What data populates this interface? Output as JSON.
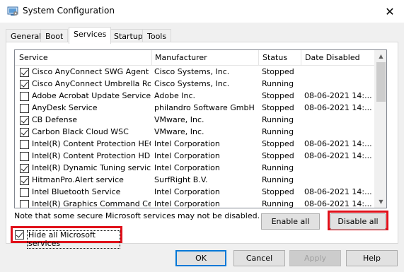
{
  "window": {
    "title": "System Configuration",
    "close_glyph": "✕"
  },
  "tabs": [
    {
      "label": "General"
    },
    {
      "label": "Boot"
    },
    {
      "label": "Services",
      "active": true
    },
    {
      "label": "Startup"
    },
    {
      "label": "Tools"
    }
  ],
  "columns": {
    "service": "Service",
    "manufacturer": "Manufacturer",
    "status": "Status",
    "date_disabled": "Date Disabled"
  },
  "services": [
    {
      "checked": true,
      "name": "Cisco AnyConnect SWG Agent",
      "manufacturer": "Cisco Systems, Inc.",
      "status": "Stopped",
      "date": ""
    },
    {
      "checked": true,
      "name": "Cisco AnyConnect Umbrella Roa...",
      "manufacturer": "Cisco Systems, Inc.",
      "status": "Running",
      "date": ""
    },
    {
      "checked": false,
      "name": "Adobe Acrobat Update Service",
      "manufacturer": "Adobe Inc.",
      "status": "Stopped",
      "date": "08-06-2021 14:..."
    },
    {
      "checked": false,
      "name": "AnyDesk Service",
      "manufacturer": "philandro Software GmbH",
      "status": "Stopped",
      "date": "08-06-2021 14:..."
    },
    {
      "checked": true,
      "name": "CB Defense",
      "manufacturer": "VMware, Inc.",
      "status": "Running",
      "date": ""
    },
    {
      "checked": true,
      "name": "Carbon Black Cloud WSC",
      "manufacturer": "VMware, Inc.",
      "status": "Running",
      "date": ""
    },
    {
      "checked": false,
      "name": "Intel(R) Content Protection HEC...",
      "manufacturer": "Intel Corporation",
      "status": "Stopped",
      "date": "08-06-2021 14:..."
    },
    {
      "checked": false,
      "name": "Intel(R) Content Protection HDC...",
      "manufacturer": "Intel Corporation",
      "status": "Stopped",
      "date": "08-06-2021 14:..."
    },
    {
      "checked": true,
      "name": "Intel(R) Dynamic Tuning service",
      "manufacturer": "Intel Corporation",
      "status": "Running",
      "date": ""
    },
    {
      "checked": true,
      "name": "HitmanPro.Alert service",
      "manufacturer": "SurfRight B.V.",
      "status": "Running",
      "date": ""
    },
    {
      "checked": false,
      "name": "Intel Bluetooth Service",
      "manufacturer": "Intel Corporation",
      "status": "Stopped",
      "date": "08-06-2021 14:..."
    },
    {
      "checked": false,
      "name": "Intel(R) Graphics Command Cen...",
      "manufacturer": "Intel Corporation",
      "status": "Running",
      "date": "08-06-2021 14:..."
    }
  ],
  "note": "Note that some secure Microsoft services may not be disabled.",
  "hide_microsoft": {
    "label": "Hide all Microsoft services",
    "checked": true
  },
  "buttons": {
    "enable_all": "Enable all",
    "disable_all": "Disable all",
    "ok": "OK",
    "cancel": "Cancel",
    "apply": "Apply",
    "help": "Help"
  },
  "scrollbar": {
    "up_glyph": "▲",
    "down_glyph": "▼"
  },
  "colors": {
    "highlight": "#e0101a",
    "accent": "#0078d7"
  }
}
